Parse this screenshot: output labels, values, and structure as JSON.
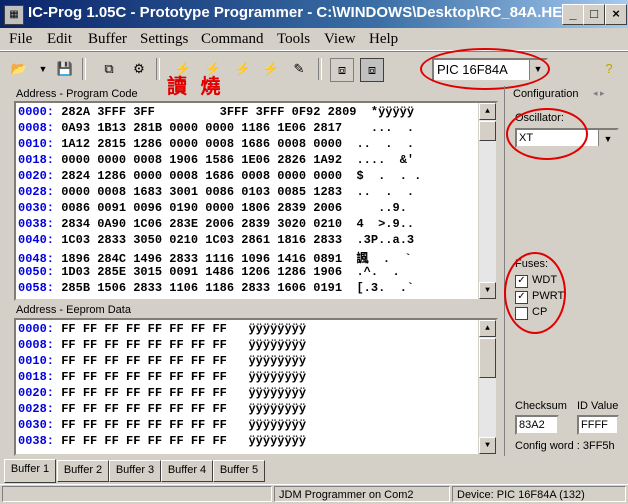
{
  "window": {
    "title": "IC-Prog 1.05C - Prototype Programmer - C:\\WINDOWS\\Desktop\\RC_84A.HEX"
  },
  "menu": [
    "File",
    "Edit",
    "Buffer",
    "Settings",
    "Command",
    "Tools",
    "View",
    "Help"
  ],
  "toolbar": {
    "device": "PIC 16F84A",
    "chinese_text": "讀 燒"
  },
  "program_code": {
    "title": "Address - Program Code",
    "rows": [
      {
        "addr": "0000:",
        "data": "282A 3FFF 3FF         3FFF 3FFF 0F92 2809",
        "ascii": "*ÿÿÿÿÿ"
      },
      {
        "addr": "0008:",
        "data": "0A93 1B13 281B 0000 0000 1186 1E06 2817",
        "ascii": "  ...  ."
      },
      {
        "addr": "0010:",
        "data": "1A12 2815 1286 0000 0008 1686 0008 0000",
        "ascii": "..  .  ."
      },
      {
        "addr": "0018:",
        "data": "0000 0000 0008 1906 1586 1E06 2826 1A92",
        "ascii": "....  &'"
      },
      {
        "addr": "0020:",
        "data": "2824 1286 0000 0008 1686 0008 0000 0000",
        "ascii": "$  .  . ."
      },
      {
        "addr": "0028:",
        "data": "0000 0008 1683 3001 0086 0103 0085 1283",
        "ascii": "..  .  ."
      },
      {
        "addr": "0030:",
        "data": "0086 0091 0096 0190 0000 1806 2839 2006",
        "ascii": "   ..9."
      },
      {
        "addr": "0038:",
        "data": "2834 0A90 1C06 283E 2006 2839 3020 0210",
        "ascii": "4  >.9.."
      },
      {
        "addr": "0040:",
        "data": "1C03 2833 3050 0210 1C03 2861 1816 2833",
        "ascii": ".3P..a.3"
      },
      {
        "addr": "0048:",
        "data": "1896 284C 1496 2833 1116 1096 1416 0891",
        "ascii": "諷  .  `"
      },
      {
        "addr": "0050:",
        "data": "1D03 285E 3015 0091 1486 1206 1286 1906",
        "ascii": ".^.  . "
      },
      {
        "addr": "0058:",
        "data": "285B 1506 2833 1106 1186 2833 1606 0191",
        "ascii": "[.3.  .`"
      }
    ]
  },
  "eeprom": {
    "title": "Address - Eeprom Data",
    "rows": [
      {
        "addr": "0000:",
        "data": "FF FF FF FF FF FF FF FF",
        "ascii": "ÿÿÿÿÿÿÿÿ"
      },
      {
        "addr": "0008:",
        "data": "FF FF FF FF FF FF FF FF",
        "ascii": "ÿÿÿÿÿÿÿÿ"
      },
      {
        "addr": "0010:",
        "data": "FF FF FF FF FF FF FF FF",
        "ascii": "ÿÿÿÿÿÿÿÿ"
      },
      {
        "addr": "0018:",
        "data": "FF FF FF FF FF FF FF FF",
        "ascii": "ÿÿÿÿÿÿÿÿ"
      },
      {
        "addr": "0020:",
        "data": "FF FF FF FF FF FF FF FF",
        "ascii": "ÿÿÿÿÿÿÿÿ"
      },
      {
        "addr": "0028:",
        "data": "FF FF FF FF FF FF FF FF",
        "ascii": "ÿÿÿÿÿÿÿÿ"
      },
      {
        "addr": "0030:",
        "data": "FF FF FF FF FF FF FF FF",
        "ascii": "ÿÿÿÿÿÿÿÿ"
      },
      {
        "addr": "0038:",
        "data": "FF FF FF FF FF FF FF FF",
        "ascii": "ÿÿÿÿÿÿÿÿ"
      }
    ]
  },
  "configuration": {
    "title": "Configuration",
    "oscillator_label": "Oscillator:",
    "oscillator_value": "XT",
    "fuses_label": "Fuses:",
    "fuses": [
      {
        "label": "WDT",
        "checked": true
      },
      {
        "label": "PWRT",
        "checked": true
      },
      {
        "label": "CP",
        "checked": false
      }
    ],
    "checksum_label": "Checksum",
    "checksum_value": "83A2",
    "id_label": "ID Value",
    "id_value": "FFFF",
    "config_word": "Config word : 3FF5h"
  },
  "tabs": [
    "Buffer 1",
    "Buffer 2",
    "Buffer 3",
    "Buffer 4",
    "Buffer 5"
  ],
  "status": {
    "programmer": "JDM Programmer on Com2",
    "device": "Device: PIC 16F84A  (132)"
  },
  "colors": {
    "address": "#0000e0",
    "annotation": "#e00000",
    "title_bar": "#0a246a"
  }
}
